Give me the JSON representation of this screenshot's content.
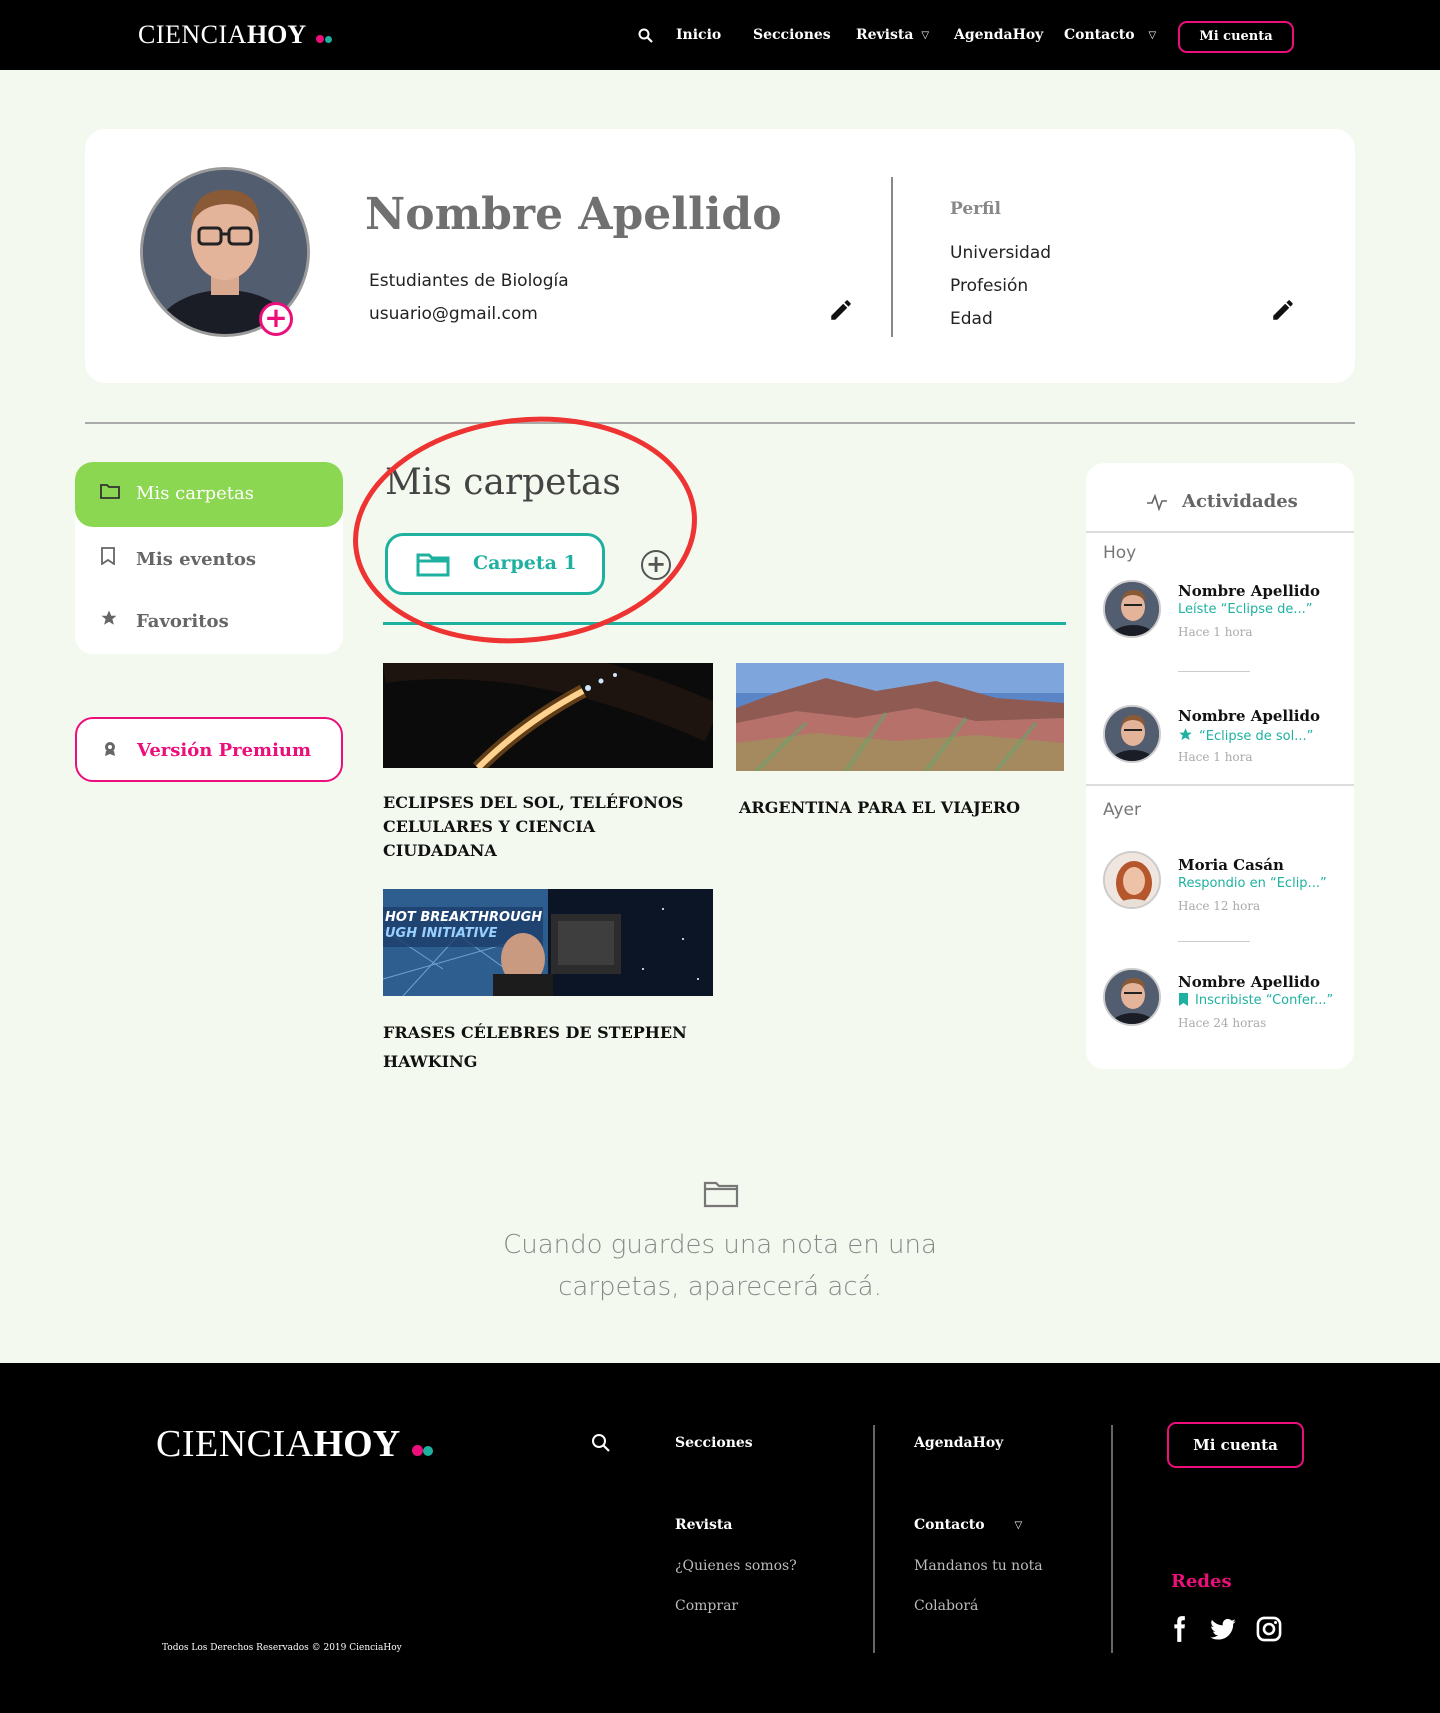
{
  "brand": {
    "logo_light": "CIENCIA",
    "logo_bold": "HOY",
    "dot_pink": "#ec0e7a",
    "dot_teal": "#1fb1a0"
  },
  "nav": {
    "search_icon": "search-icon",
    "items": [
      "Inicio",
      "Secciones",
      "Revista",
      "AgendaHoy",
      "Contacto"
    ],
    "account_button": "Mi cuenta"
  },
  "profile": {
    "name": "Nombre Apellido",
    "group": "Estudiantes de Biología",
    "email": "usuario@gmail.com",
    "perfil_label": "Perfil",
    "perfil_items": [
      "Universidad",
      "Profesión",
      "Edad"
    ]
  },
  "sidebar": {
    "items": [
      {
        "label": "Mis carpetas",
        "icon": "folder-icon",
        "active": true
      },
      {
        "label": "Mis eventos",
        "icon": "bookmark-icon",
        "active": false
      },
      {
        "label": "Favoritos",
        "icon": "star-icon",
        "active": false
      }
    ],
    "premium": "Versión Premium"
  },
  "main": {
    "title": "Mis carpetas",
    "folder_tab": "Carpeta 1",
    "articles": [
      {
        "title_line1": "ECLIPSES DEL SOL, TELÉFONOS",
        "title_line2": "CELULARES Y CIENCIA CIUDADANA"
      },
      {
        "title_line1": "ARGENTINA PARA EL VIAJERO",
        "title_line2": ""
      },
      {
        "title_line1": "FRASES CÉLEBRES DE STEPHEN",
        "title_line2": "HAWKING"
      }
    ],
    "image_text": "HOT BREAKTHROUGH INITIATIVE",
    "empty_line1": "Cuando guardes una nota en una",
    "empty_line2": "carpetas, aparecerá acá."
  },
  "activities": {
    "title": "Actividades",
    "today": "Hoy",
    "yesterday": "Ayer",
    "entries": [
      {
        "name": "Nombre Apellido",
        "desc": "Leíste “Eclipse de...”",
        "time": "Hace 1 hora"
      },
      {
        "name": "Nombre Apellido",
        "desc": "“Eclipse de sol...”",
        "time": "Hace 1 hora"
      },
      {
        "name": "Moria Casán",
        "desc": "Respondio en “Eclip...”",
        "time": "Hace 12 hora"
      },
      {
        "name": "Nombre Apellido",
        "desc": "Inscribiste “Confer...”",
        "time": "Hace 24 horas"
      }
    ]
  },
  "footer": {
    "links": [
      "Secciones",
      "AgendaHoy",
      "Revista",
      "Contacto"
    ],
    "sub_links_left": [
      "¿Quienes somos?",
      "Comprar"
    ],
    "sub_links_right": [
      "Mandanos tu nota",
      "Colaborá"
    ],
    "account_button": "Mi cuenta",
    "redes": "Redes",
    "copyright": "Todos Los Derechos Reservados © 2019 CienciaHoy"
  }
}
